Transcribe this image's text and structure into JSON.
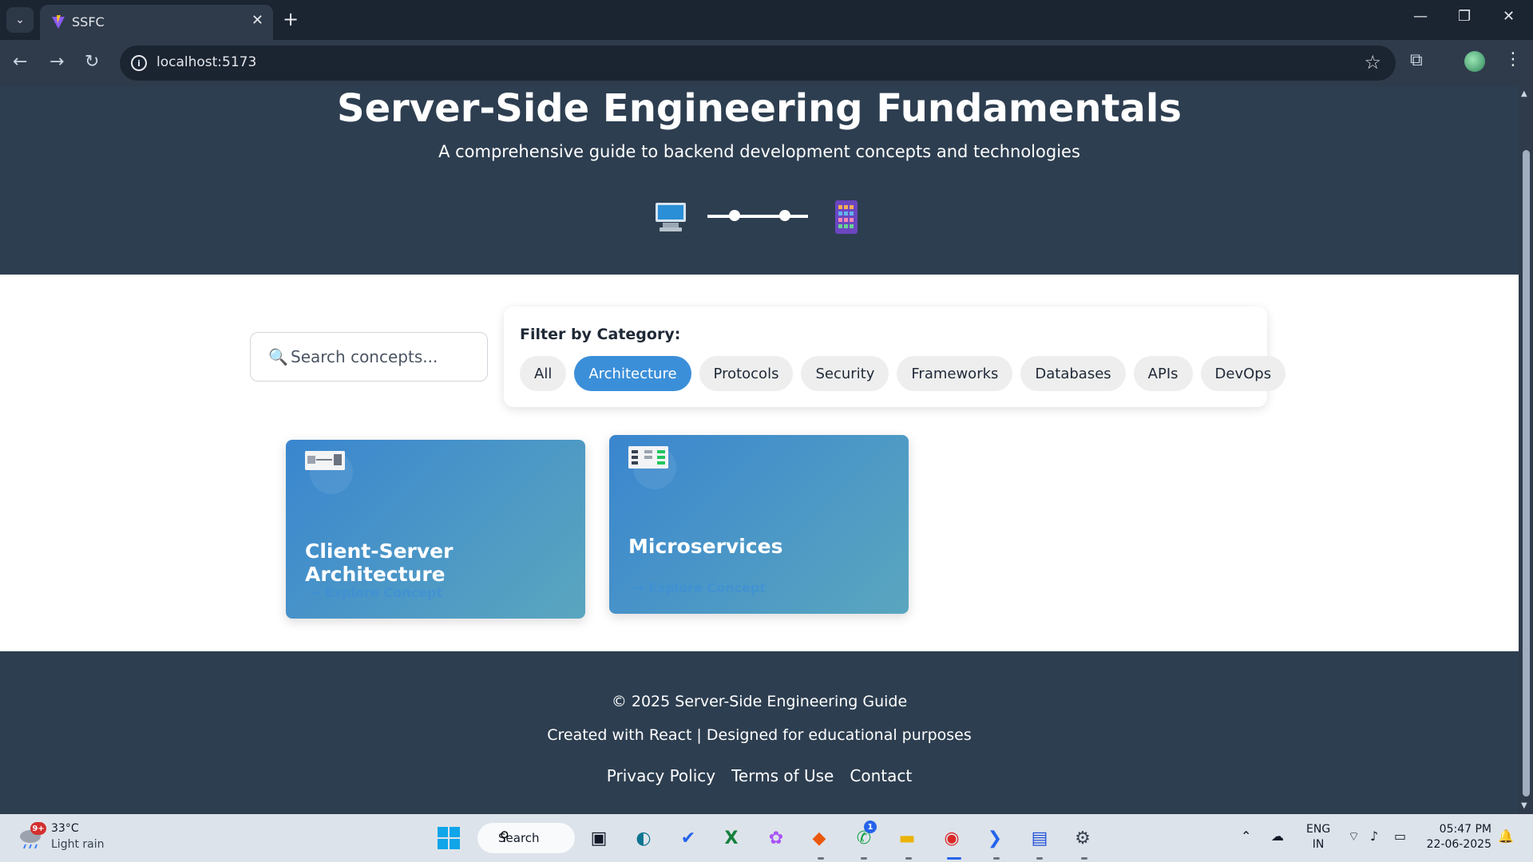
{
  "browser": {
    "tab_title": "SSFC",
    "url": "localhost:5173"
  },
  "hero": {
    "title": "Server-Side Engineering Fundamentals",
    "subtitle": "A comprehensive guide to backend development concepts and technologies"
  },
  "search": {
    "placeholder": "Search concepts..."
  },
  "filter": {
    "label": "Filter by Category:",
    "categories": [
      "All",
      "Architecture",
      "Protocols",
      "Security",
      "Frameworks",
      "Databases",
      "APIs",
      "DevOps"
    ],
    "active": "Architecture"
  },
  "cards": [
    {
      "title": "Client-Server Architecture",
      "link": "→ Explore Concept"
    },
    {
      "title": "Microservices",
      "link": "→ Explore Concept"
    }
  ],
  "footer": {
    "copyright": "© 2025 Server-Side Engineering Guide",
    "credit": "Created with React | Designed for educational purposes",
    "links": [
      "Privacy Policy",
      "Terms of Use",
      "Contact"
    ]
  },
  "taskbar": {
    "weather_badge": "9+",
    "temperature": "33°C",
    "weather": "Light rain",
    "search_label": "Search",
    "whatsapp_badge": "1",
    "lang_line1": "ENG",
    "lang_line2": "IN",
    "time": "05:47 PM",
    "date": "22-06-2025"
  },
  "colors": {
    "hero_bg": "#2d3e50",
    "accent": "#3b8fd9",
    "card_gradient_start": "#3a86cf",
    "card_gradient_end": "#5aa6bf"
  }
}
